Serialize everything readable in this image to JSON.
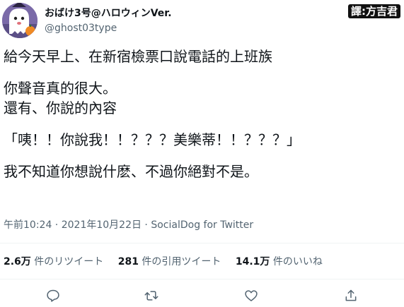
{
  "header": {
    "display_name": "おばけ3号@ハロウィンVer.",
    "handle": "@ghost03type",
    "translator_badge": "譯:方吉君"
  },
  "tweet": {
    "lines": [
      "給今天早上、在新宿檢票口說電話的上班族",
      "",
      "你聲音真的很大。",
      "還有、你說的內容",
      "",
      "「咦！！你說我！！？？？美樂蒂！！？？？」",
      "",
      "我不知道你想說什麽、不過你絕對不是。"
    ]
  },
  "meta": {
    "time": "午前10:24",
    "separator1": " · ",
    "date": "2021年10月22日",
    "separator2": " · ",
    "source": "SocialDog for Twitter"
  },
  "stats": {
    "retweets_count": "2.6万",
    "retweets_label": "件のリツイート",
    "quotes_count": "281",
    "quotes_label": "件の引用ツイート",
    "likes_count": "14.1万",
    "likes_label": "件のいいね"
  },
  "actions": {
    "reply_icon": "reply-icon",
    "retweet_icon": "retweet-icon",
    "like_icon": "like-icon",
    "share_icon": "share-icon"
  }
}
